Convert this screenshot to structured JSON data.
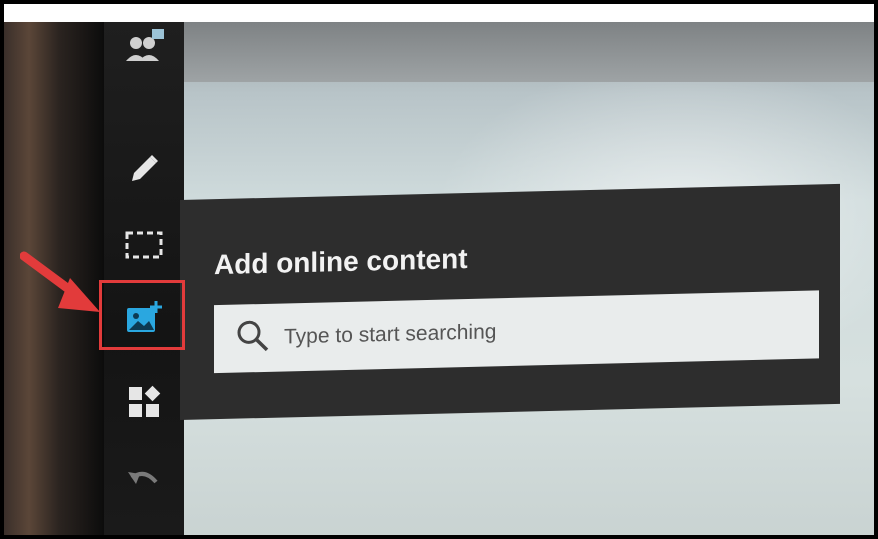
{
  "dialog": {
    "title": "Add online content",
    "search_placeholder": "Type to start searching"
  },
  "toolbar": {
    "tools": [
      {
        "name": "users-icon"
      },
      {
        "name": "pencil-icon"
      },
      {
        "name": "selection-icon"
      },
      {
        "name": "add-image-icon",
        "highlighted": true
      },
      {
        "name": "widgets-icon"
      },
      {
        "name": "undo-icon"
      }
    ]
  },
  "colors": {
    "highlight_border": "#e23b3b",
    "arrow": "#e23b3b",
    "active_icon": "#2aa7e0",
    "dialog_bg": "#2d2d2d",
    "search_bg": "#e9ecec"
  }
}
